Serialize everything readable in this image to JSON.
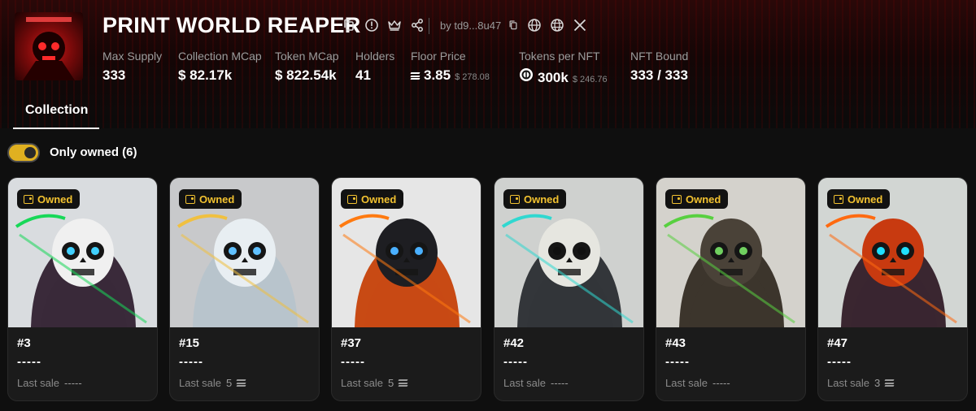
{
  "collection": {
    "title": "PRINT WORLD REAPER",
    "byline": "by td9...8u47"
  },
  "stats": [
    {
      "label": "Max Supply",
      "value": "333",
      "sub": ""
    },
    {
      "label": "Collection MCap",
      "value": "$ 82.17k",
      "sub": ""
    },
    {
      "label": "Token MCap",
      "value": "$ 822.54k",
      "sub": ""
    },
    {
      "label": "Holders",
      "value": "41",
      "sub": ""
    },
    {
      "label": "Floor Price",
      "value": "3.85",
      "sub": "$ 278.08"
    },
    {
      "label": "Tokens per NFT",
      "value": "300k",
      "sub": "$ 246.76"
    },
    {
      "label": "NFT Bound",
      "value": "333 / 333",
      "sub": ""
    }
  ],
  "tabs": {
    "active": "Collection"
  },
  "filter": {
    "label": "Only owned (6)",
    "enabled": true
  },
  "cards": [
    {
      "badge": "Owned",
      "number": "#3",
      "name": "-----",
      "sale_label": "Last sale",
      "sale_value": "-----",
      "sol": false,
      "bg": "#d9dcdf"
    },
    {
      "badge": "Owned",
      "number": "#15",
      "name": "-----",
      "sale_label": "Last sale",
      "sale_value": "5",
      "sol": true,
      "bg": "#c8c9cb"
    },
    {
      "badge": "Owned",
      "number": "#37",
      "name": "-----",
      "sale_label": "Last sale",
      "sale_value": "5",
      "sol": true,
      "bg": "#e6e6e6"
    },
    {
      "badge": "Owned",
      "number": "#42",
      "name": "-----",
      "sale_label": "Last sale",
      "sale_value": "-----",
      "sol": false,
      "bg": "#cfd1cf"
    },
    {
      "badge": "Owned",
      "number": "#43",
      "name": "-----",
      "sale_label": "Last sale",
      "sale_value": "-----",
      "sol": false,
      "bg": "#d4d2cc"
    },
    {
      "badge": "Owned",
      "number": "#47",
      "name": "-----",
      "sale_label": "Last sale",
      "sale_value": "3",
      "sol": true,
      "bg": "#d2d6d3"
    }
  ],
  "colors": {
    "accent": "#f2c230",
    "background": "#0f0f0f",
    "card": "#1b1b1b"
  }
}
